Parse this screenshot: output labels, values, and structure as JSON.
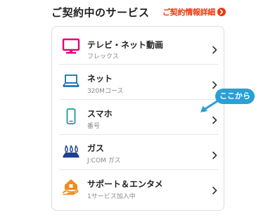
{
  "header": {
    "title": "ご契約中のサービス",
    "detail_link": "ご契約情報詳細"
  },
  "services": [
    {
      "name": "テレビ・ネット動画",
      "sub": "フレックス",
      "icon": "tv-icon"
    },
    {
      "name": "ネット",
      "sub": "320Mコース",
      "icon": "laptop-icon"
    },
    {
      "name": "スマホ",
      "sub": "番号",
      "icon": "smartphone-icon"
    },
    {
      "name": "ガス",
      "sub": "J:COM ガス",
      "icon": "gas-flame-icon"
    },
    {
      "name": "サポート＆エンタメ",
      "sub": "1サービス加入中",
      "icon": "support-home-icon"
    }
  ],
  "callout": {
    "label": "ここから"
  },
  "colors": {
    "accent_red": "#e8380d",
    "tv_pink": "#e4007f",
    "laptop_blue": "#1a6fb5",
    "phone_teal": "#1e9a9a",
    "gas_navy": "#1f3f8f",
    "support_orange": "#f08c1e",
    "callout_blue": "#29a0d6"
  }
}
